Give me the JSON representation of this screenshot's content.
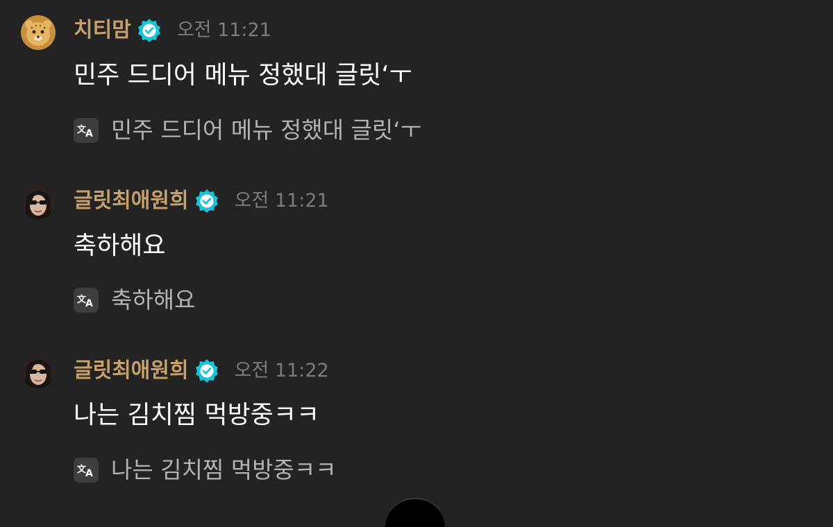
{
  "messages": [
    {
      "nickname": "치티맘",
      "time": "오전 11:21",
      "text": "민주 드디어 메뉴 정했대 글릿‘ㅜ",
      "translation": "민주 드디어 메뉴 정했대 글릿‘ㅜ",
      "avatar": "cheetah-avatar"
    },
    {
      "nickname": "글릿최애원희",
      "time": "오전 11:21",
      "text": "축하해요",
      "translation": "축하해요",
      "avatar": "sunglasses-avatar"
    },
    {
      "nickname": "글릿최애원희",
      "time": "오전 11:22",
      "text": "나는 김치찜 먹방중ㅋㅋ",
      "translation": "나는 김치찜 먹방중ㅋㅋ",
      "avatar": "sunglasses-avatar"
    }
  ],
  "icons": {
    "verified": "verified-badge-icon",
    "translate": "translate-icon"
  },
  "colors": {
    "background": "#232323",
    "nickname": "#c8a06a",
    "verified": "#19c3d8",
    "time": "#7d7d7d",
    "message": "#ffffff",
    "translation": "#b3b3b3"
  }
}
